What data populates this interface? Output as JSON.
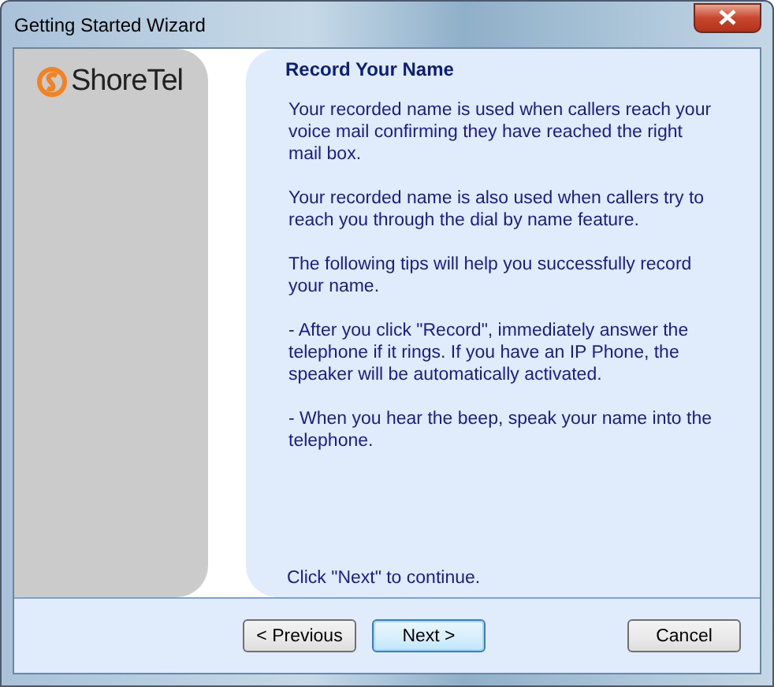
{
  "window": {
    "title": "Getting Started Wizard"
  },
  "logo": "ShoreTel",
  "heading": "Record Your Name",
  "paragraphs": [
    "Your recorded name is used when callers reach your voice mail confirming they have reached the right mail box.",
    "Your recorded name is also used when callers try to reach you through the dial by name feature.",
    "The following tips will help you successfully record your name.",
    "- After you click \"Record\", immediately answer the telephone if it rings.  If you have an IP Phone, the speaker will be automatically activated.",
    "- When you hear the beep, speak your name into the telephone."
  ],
  "footer_hint": "Click \"Next\" to continue.",
  "buttons": [
    {
      "label": "< Previous",
      "default": false
    },
    {
      "label": "Next >",
      "default": true
    },
    {
      "label": "Cancel",
      "default": false
    }
  ]
}
